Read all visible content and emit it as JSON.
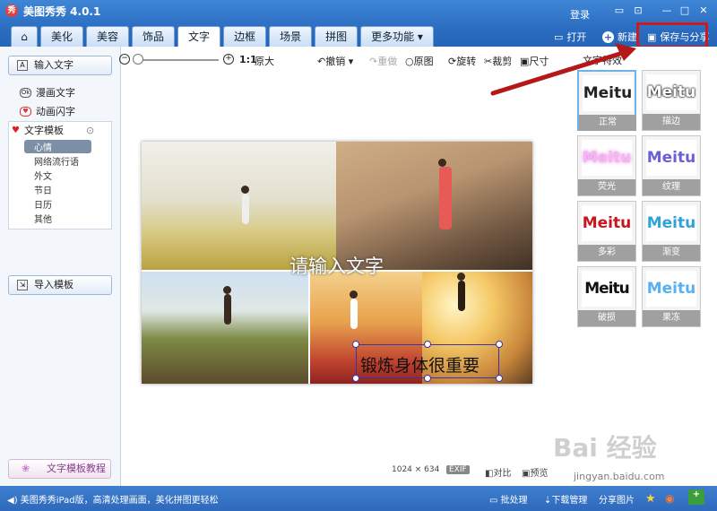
{
  "app": {
    "title": "美图秀秀 4.0.1",
    "login": "登录"
  },
  "tabs": [
    {
      "label": "美化"
    },
    {
      "label": "美容"
    },
    {
      "label": "饰品"
    },
    {
      "label": "文字"
    },
    {
      "label": "边框"
    },
    {
      "label": "场景"
    },
    {
      "label": "拼图"
    },
    {
      "label": "更多功能 ▾"
    }
  ],
  "header": {
    "open": "打开",
    "new": "新建",
    "save": "保存与分享"
  },
  "left": {
    "input_text": "输入文字",
    "comic_text": "漫画文字",
    "anim_text": "动画闪字",
    "template": "文字模板",
    "subs": [
      "心情",
      "网络流行语",
      "外文",
      "节日",
      "日历",
      "其他"
    ],
    "import": "导入模板",
    "tutorial": "文字模板教程"
  },
  "toolbar": {
    "ratio": "1:1",
    "original_size": "原大",
    "undo": "撤销",
    "redo": "重做",
    "original": "原图",
    "rotate": "旋转",
    "crop": "裁剪",
    "size": "尺寸"
  },
  "canvas": {
    "overlay": "请输入文字",
    "selected": "锻炼身体很重要"
  },
  "status": {
    "dims": "1024 × 634",
    "exif": "EXIF",
    "compare": "对比",
    "preview": "预览"
  },
  "right": {
    "title": "文字特效",
    "effects": [
      {
        "preview": "Meitu",
        "label": "正常",
        "color": "#222222"
      },
      {
        "preview": "Meitu",
        "label": "描边",
        "color": "#000000"
      },
      {
        "preview": "Meitu",
        "label": "荧光",
        "color": "#f4b6f0"
      },
      {
        "preview": "Meitu",
        "label": "纹理",
        "color": "#6b5fd6"
      },
      {
        "preview": "Meitu",
        "label": "多彩",
        "color": "#c7161d"
      },
      {
        "preview": "Meitu",
        "label": "渐变",
        "color": "#2fa2db"
      },
      {
        "preview": "Meitu",
        "label": "破损",
        "color": "#111111"
      },
      {
        "preview": "Meitu",
        "label": "果冻",
        "color": "#57b0f0"
      }
    ]
  },
  "statusbar": {
    "promo": "美图秀秀iPad版，高清处理画面，美化拼图更轻松",
    "batch": "批处理",
    "download": "下载管理",
    "share": "分享图片"
  },
  "watermark": {
    "brand": "Bai 经验",
    "url": "jingyan.baidu.com"
  }
}
